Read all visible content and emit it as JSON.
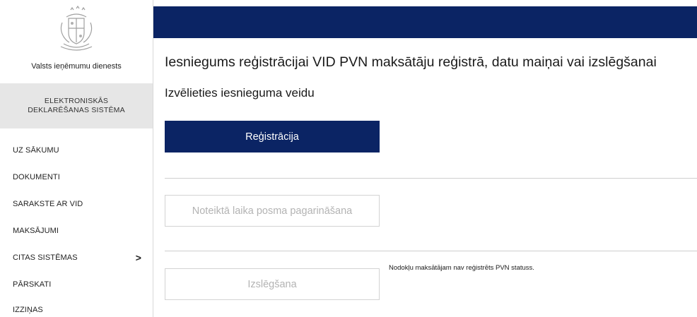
{
  "sidebar": {
    "org_name": "Valsts ieņēmumu dienests",
    "eds_line1": "ELEKTRONISKĀS",
    "eds_line2": "DEKLARĒŠANAS SISTĒMA",
    "items": [
      {
        "label": "UZ SĀKUMU"
      },
      {
        "label": "DOKUMENTI"
      },
      {
        "label": "SARAKSTE AR VID"
      },
      {
        "label": "MAKSĀJUMI"
      },
      {
        "label": "CITAS SISTĒMAS",
        "chevron": ">"
      },
      {
        "label": "PĀRSKATI"
      },
      {
        "label": "IZZIŅAS"
      }
    ]
  },
  "colors": {
    "brand_navy": "#0b2464",
    "sidebar_gray": "#e6e6e6"
  },
  "main": {
    "title": "Iesniegums reģistrācijai VID PVN maksātāju reģistrā, datu maiņai vai izslēgšanai",
    "subtitle": "Izvēlieties iesnieguma veidu",
    "buttons": {
      "registration": "Reģistrācija",
      "extension": "Noteiktā laika posma pagarināšana",
      "removal": "Izslēgšana"
    },
    "note": "Nodokļu maksātājam nav reģistrēts PVN statuss."
  }
}
